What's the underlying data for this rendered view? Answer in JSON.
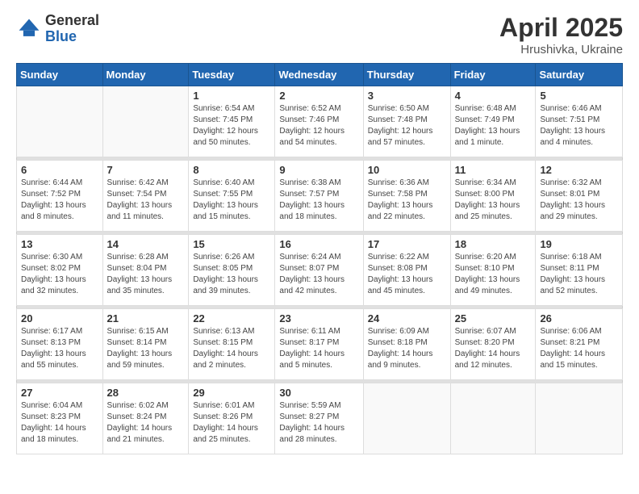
{
  "logo": {
    "general": "General",
    "blue": "Blue"
  },
  "title": {
    "month": "April 2025",
    "location": "Hrushivka, Ukraine"
  },
  "weekdays": [
    "Sunday",
    "Monday",
    "Tuesday",
    "Wednesday",
    "Thursday",
    "Friday",
    "Saturday"
  ],
  "weeks": [
    [
      {
        "day": "",
        "info": ""
      },
      {
        "day": "",
        "info": ""
      },
      {
        "day": "1",
        "info": "Sunrise: 6:54 AM\nSunset: 7:45 PM\nDaylight: 12 hours and 50 minutes."
      },
      {
        "day": "2",
        "info": "Sunrise: 6:52 AM\nSunset: 7:46 PM\nDaylight: 12 hours and 54 minutes."
      },
      {
        "day": "3",
        "info": "Sunrise: 6:50 AM\nSunset: 7:48 PM\nDaylight: 12 hours and 57 minutes."
      },
      {
        "day": "4",
        "info": "Sunrise: 6:48 AM\nSunset: 7:49 PM\nDaylight: 13 hours and 1 minute."
      },
      {
        "day": "5",
        "info": "Sunrise: 6:46 AM\nSunset: 7:51 PM\nDaylight: 13 hours and 4 minutes."
      }
    ],
    [
      {
        "day": "6",
        "info": "Sunrise: 6:44 AM\nSunset: 7:52 PM\nDaylight: 13 hours and 8 minutes."
      },
      {
        "day": "7",
        "info": "Sunrise: 6:42 AM\nSunset: 7:54 PM\nDaylight: 13 hours and 11 minutes."
      },
      {
        "day": "8",
        "info": "Sunrise: 6:40 AM\nSunset: 7:55 PM\nDaylight: 13 hours and 15 minutes."
      },
      {
        "day": "9",
        "info": "Sunrise: 6:38 AM\nSunset: 7:57 PM\nDaylight: 13 hours and 18 minutes."
      },
      {
        "day": "10",
        "info": "Sunrise: 6:36 AM\nSunset: 7:58 PM\nDaylight: 13 hours and 22 minutes."
      },
      {
        "day": "11",
        "info": "Sunrise: 6:34 AM\nSunset: 8:00 PM\nDaylight: 13 hours and 25 minutes."
      },
      {
        "day": "12",
        "info": "Sunrise: 6:32 AM\nSunset: 8:01 PM\nDaylight: 13 hours and 29 minutes."
      }
    ],
    [
      {
        "day": "13",
        "info": "Sunrise: 6:30 AM\nSunset: 8:02 PM\nDaylight: 13 hours and 32 minutes."
      },
      {
        "day": "14",
        "info": "Sunrise: 6:28 AM\nSunset: 8:04 PM\nDaylight: 13 hours and 35 minutes."
      },
      {
        "day": "15",
        "info": "Sunrise: 6:26 AM\nSunset: 8:05 PM\nDaylight: 13 hours and 39 minutes."
      },
      {
        "day": "16",
        "info": "Sunrise: 6:24 AM\nSunset: 8:07 PM\nDaylight: 13 hours and 42 minutes."
      },
      {
        "day": "17",
        "info": "Sunrise: 6:22 AM\nSunset: 8:08 PM\nDaylight: 13 hours and 45 minutes."
      },
      {
        "day": "18",
        "info": "Sunrise: 6:20 AM\nSunset: 8:10 PM\nDaylight: 13 hours and 49 minutes."
      },
      {
        "day": "19",
        "info": "Sunrise: 6:18 AM\nSunset: 8:11 PM\nDaylight: 13 hours and 52 minutes."
      }
    ],
    [
      {
        "day": "20",
        "info": "Sunrise: 6:17 AM\nSunset: 8:13 PM\nDaylight: 13 hours and 55 minutes."
      },
      {
        "day": "21",
        "info": "Sunrise: 6:15 AM\nSunset: 8:14 PM\nDaylight: 13 hours and 59 minutes."
      },
      {
        "day": "22",
        "info": "Sunrise: 6:13 AM\nSunset: 8:15 PM\nDaylight: 14 hours and 2 minutes."
      },
      {
        "day": "23",
        "info": "Sunrise: 6:11 AM\nSunset: 8:17 PM\nDaylight: 14 hours and 5 minutes."
      },
      {
        "day": "24",
        "info": "Sunrise: 6:09 AM\nSunset: 8:18 PM\nDaylight: 14 hours and 9 minutes."
      },
      {
        "day": "25",
        "info": "Sunrise: 6:07 AM\nSunset: 8:20 PM\nDaylight: 14 hours and 12 minutes."
      },
      {
        "day": "26",
        "info": "Sunrise: 6:06 AM\nSunset: 8:21 PM\nDaylight: 14 hours and 15 minutes."
      }
    ],
    [
      {
        "day": "27",
        "info": "Sunrise: 6:04 AM\nSunset: 8:23 PM\nDaylight: 14 hours and 18 minutes."
      },
      {
        "day": "28",
        "info": "Sunrise: 6:02 AM\nSunset: 8:24 PM\nDaylight: 14 hours and 21 minutes."
      },
      {
        "day": "29",
        "info": "Sunrise: 6:01 AM\nSunset: 8:26 PM\nDaylight: 14 hours and 25 minutes."
      },
      {
        "day": "30",
        "info": "Sunrise: 5:59 AM\nSunset: 8:27 PM\nDaylight: 14 hours and 28 minutes."
      },
      {
        "day": "",
        "info": ""
      },
      {
        "day": "",
        "info": ""
      },
      {
        "day": "",
        "info": ""
      }
    ]
  ]
}
